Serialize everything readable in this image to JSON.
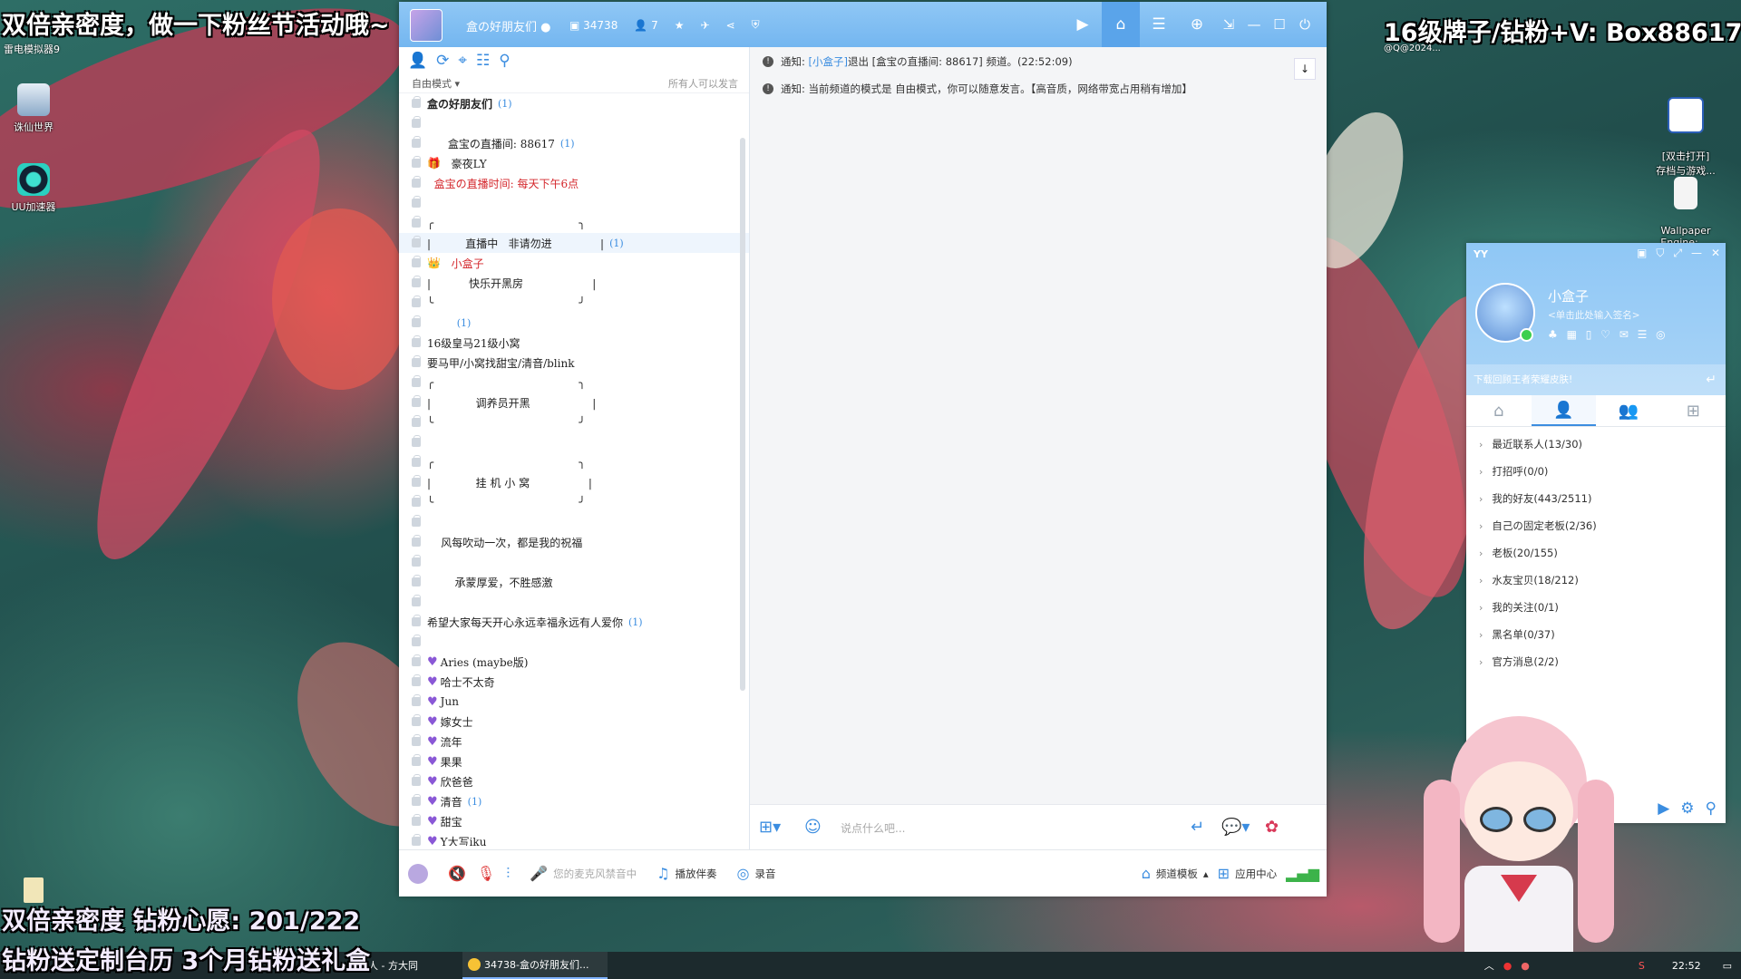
{
  "overlays": {
    "top_left": "双倍亲密度，做一下粉丝节活动哦~",
    "top_right": "16级牌子/钻粉+V: Box88617",
    "top_right_sub": "@Q@2024...",
    "bottom1": "双倍亲密度 钻粉心愿: 201/222",
    "bottom2": "钻粉送定制台历 3个月钻粉送礼盒"
  },
  "desktop": {
    "leidian": "雷电模拟器9",
    "icon1": "诛仙世界",
    "icon2": "UU加速器",
    "icon3": "[双击打开]\n存档与游戏...",
    "icon4": "Wallpaper\nEngine: ..."
  },
  "yy": {
    "channel_name": "盒の好朋友们",
    "channel_id": "34738",
    "online_count": "7",
    "mode": "自由模式",
    "speak_policy": "所有人可以发言",
    "notices": [
      {
        "prefix": "通知:",
        "user": "[小盒子]",
        "text1": " 退出 [",
        "text2": " 盒宝の直播间: 88617",
        "text3": "] 频道。(22:52:09)"
      },
      {
        "prefix": "通知:",
        "text": "当前频道的模式是 自由模式，你可以随意发言。【高音质，网络带宽占用稍有增加】"
      }
    ],
    "input_placeholder": "说点什么吧...",
    "bottom": {
      "mic": "您的麦克风禁音中",
      "music": "播放伴奏",
      "record": "录音",
      "template": "频道模板",
      "apps": "应用中心"
    }
  },
  "tree": [
    {
      "text": "盒の好朋友们",
      "count": "(1)",
      "bold": true
    },
    {
      "text": ""
    },
    {
      "text": "      盒宝の直播间: 88617",
      "count": "(1)"
    },
    {
      "text": "  豪夜LY",
      "user": true
    },
    {
      "text": "  盒宝の直播时间: 每天下午6点",
      "red": true
    },
    {
      "text": ""
    },
    {
      "text": "╭                                          ╮"
    },
    {
      "text": "|          直播中   非请勿进              |",
      "count": "(1)",
      "hl": true
    },
    {
      "text": "  小盒子",
      "user2": true
    },
    {
      "text": "|           快乐开黑房                    |"
    },
    {
      "text": "╰                                          ╯"
    },
    {
      "text": "       ",
      "count": "(1)"
    },
    {
      "text": "16级皇马21级小窝"
    },
    {
      "text": "要马甲/小窝找甜宝/清音/blink"
    },
    {
      "text": "╭                                          ╮"
    },
    {
      "text": "|             调养员开黑                  |"
    },
    {
      "text": "╰                                          ╯"
    },
    {
      "text": ""
    },
    {
      "text": "╭                                          ╮"
    },
    {
      "text": "|             挂 机 小 窝                 |"
    },
    {
      "text": "╰                                          ╯"
    },
    {
      "text": ""
    },
    {
      "text": "    风每吹动一次，都是我的祝福"
    },
    {
      "text": ""
    },
    {
      "text": "        承蒙厚爱，不胜感激"
    },
    {
      "text": ""
    },
    {
      "text": "希望大家每天开心永远幸福永远有人爱你",
      "count": "(1)"
    },
    {
      "text": ""
    },
    {
      "text": "Aries (maybe版)",
      "heart": true
    },
    {
      "text": "哈士不太奇",
      "heart": true
    },
    {
      "text": "Jun",
      "heart": true
    },
    {
      "text": "嫁女士",
      "heart": true
    },
    {
      "text": "流年",
      "heart": true
    },
    {
      "text": "果果",
      "heart": true
    },
    {
      "text": "欣爸爸",
      "heart": true
    },
    {
      "text": "清音",
      "heart": true,
      "count": "(1)"
    },
    {
      "text": "甜宝",
      "heart": true
    },
    {
      "text": "Y大写iku",
      "heart": true
    }
  ],
  "friends": {
    "logo": "YY",
    "nick": "小盒子",
    "signature": "<单击此处输入签名>",
    "ad": "下载回顾王者荣耀皮肤!",
    "groups": [
      "最近联系人(13/30)",
      "打招呼(0/0)",
      "我的好友(443/2511)",
      "自己の固定老板(2/36)",
      "老板(20/155)",
      "水友宝贝(18/212)",
      "我的关注(0/1)",
      "黑名单(0/37)",
      "官方消息(2/2)"
    ]
  },
  "taskbar": {
    "item1": "人 - 方大同",
    "item2": "34738-盒の好朋友们...",
    "time": "22:52"
  }
}
